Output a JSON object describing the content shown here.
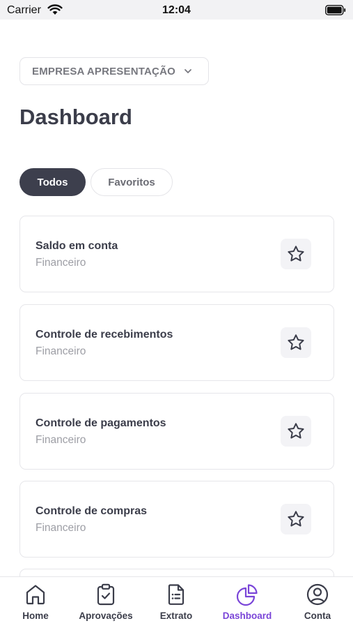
{
  "status_bar": {
    "carrier": "Carrier",
    "time": "12:04"
  },
  "company_selector": {
    "label": "EMPRESA APRESENTAÇÃO"
  },
  "page_title": "Dashboard",
  "tabs": [
    {
      "label": "Todos",
      "selected": true
    },
    {
      "label": "Favoritos",
      "selected": false
    }
  ],
  "cards": [
    {
      "title": "Saldo em conta",
      "category": "Financeiro"
    },
    {
      "title": "Controle de recebimentos",
      "category": "Financeiro"
    },
    {
      "title": "Controle de pagamentos",
      "category": "Financeiro"
    },
    {
      "title": "Controle de compras",
      "category": "Financeiro"
    }
  ],
  "bottom_nav": [
    {
      "label": "Home",
      "icon": "home-icon"
    },
    {
      "label": "Aprovações",
      "icon": "clipboard-check-icon"
    },
    {
      "label": "Extrato",
      "icon": "document-list-icon"
    },
    {
      "label": "Dashboard",
      "icon": "pie-chart-icon",
      "active": true
    },
    {
      "label": "Conta",
      "icon": "user-circle-icon"
    }
  ],
  "colors": {
    "accent": "#7a45d8",
    "tab_selected_bg": "#3d3f4d",
    "text_primary": "#3b3d4a",
    "text_secondary": "#9d9ea5"
  }
}
